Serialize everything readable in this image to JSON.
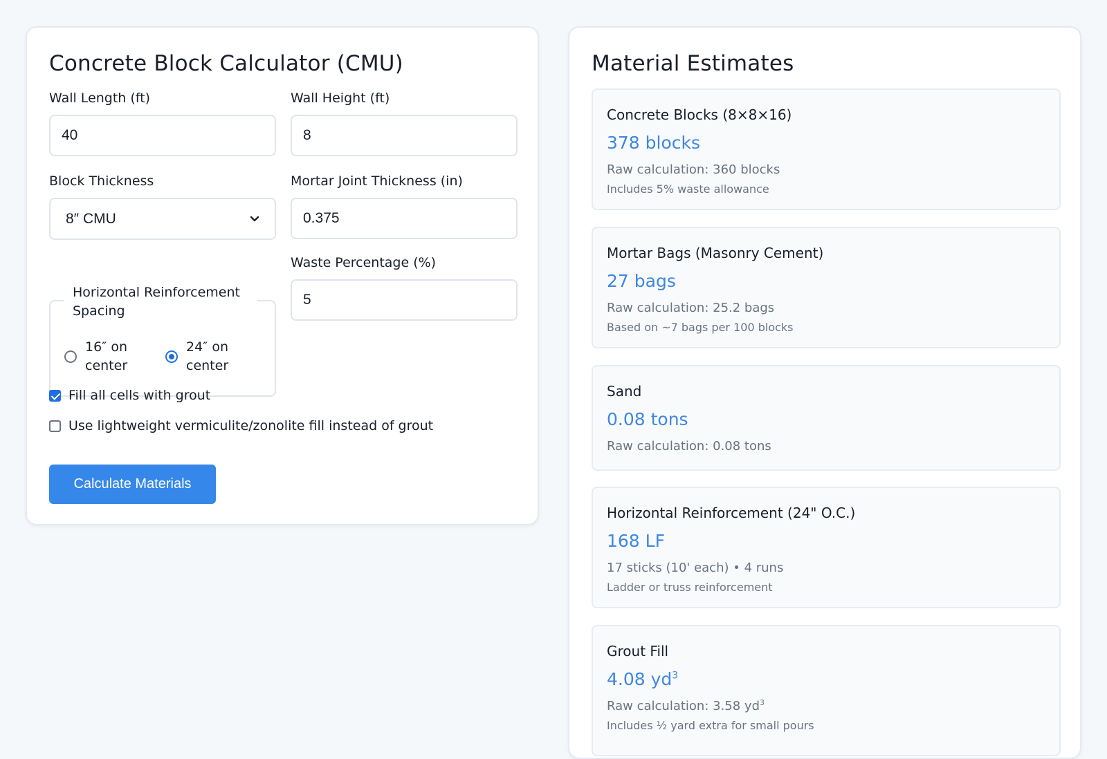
{
  "calculator": {
    "title": "Concrete Block Calculator (CMU)",
    "wall_length": {
      "label": "Wall Length (ft)",
      "value": "40"
    },
    "wall_height": {
      "label": "Wall Height (ft)",
      "value": "8"
    },
    "block_thickness": {
      "label": "Block Thickness",
      "selected": "8″ CMU"
    },
    "mortar_joint": {
      "label": "Mortar Joint Thickness (in)",
      "value": "0.375"
    },
    "reinforcement": {
      "legend": "Horizontal Reinforcement Spacing",
      "options": [
        {
          "label": "16″ on center",
          "checked": false
        },
        {
          "label": "24″ on center",
          "checked": true
        }
      ]
    },
    "waste": {
      "label": "Waste Percentage (%)",
      "value": "5"
    },
    "fill_grout": {
      "label": "Fill all cells with grout",
      "checked": true
    },
    "lightweight_fill": {
      "label": "Use lightweight vermiculite/zonolite fill instead of grout",
      "checked": false
    },
    "calculate_label": "Calculate Materials"
  },
  "estimates": {
    "title": "Material Estimates",
    "cards": [
      {
        "title": "Concrete Blocks (8×8×16)",
        "value": "378 blocks",
        "raw": "Raw calculation: 360 blocks",
        "note": "Includes 5% waste allowance"
      },
      {
        "title": "Mortar Bags (Masonry Cement)",
        "value": "27 bags",
        "raw": "Raw calculation: 25.2 bags",
        "note": "Based on ~7 bags per 100 blocks"
      },
      {
        "title": "Sand",
        "value": "0.08 tons",
        "raw": "Raw calculation: 0.08 tons",
        "note": ""
      },
      {
        "title": "Horizontal Reinforcement (24\" O.C.)",
        "value": "168 LF",
        "raw": "17 sticks (10' each) • 4 runs",
        "note": "Ladder or truss reinforcement"
      },
      {
        "title": "Grout Fill",
        "value": "4.08 yd",
        "value_sup": "3",
        "raw": "Raw calculation: 3.58 yd",
        "raw_sup": "3",
        "note": "Includes ½ yard extra for small pours"
      }
    ]
  },
  "colors": {
    "accent": "#3587ea",
    "value_text": "#3f87df",
    "muted_text": "#6b7380"
  }
}
